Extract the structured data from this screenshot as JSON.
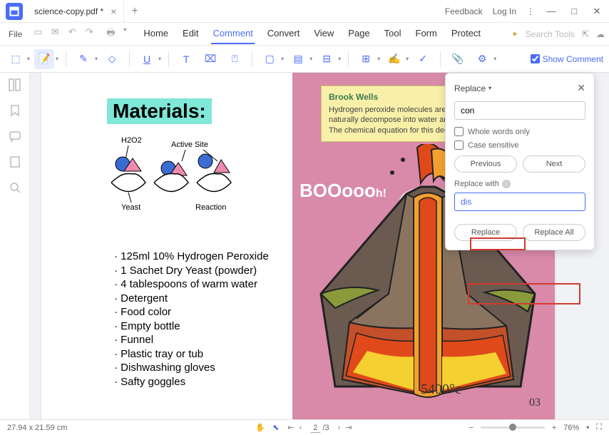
{
  "title": {
    "doc_name": "science-copy.pdf *",
    "feedback": "Feedback",
    "login": "Log In"
  },
  "menubar": {
    "file": "File",
    "items": [
      "Home",
      "Edit",
      "Comment",
      "Convert",
      "View",
      "Page",
      "Tool",
      "Form",
      "Protect"
    ],
    "active_index": 2,
    "search_placeholder": "Search Tools"
  },
  "toolbar": {
    "show_comment": "Show Comment"
  },
  "doc": {
    "materials_title": "Materials:",
    "diagram_labels": {
      "h2o2": "H2O2",
      "active": "Active Site",
      "yeast": "Yeast",
      "reaction": "Reaction"
    },
    "materials": [
      "125ml 10% Hydrogen Peroxide",
      "1 Sachet Dry Yeast (powder)",
      "4 tablespoons of warm water",
      "Detergent",
      "Food color",
      "Empty bottle",
      "Funnel",
      "Plastic tray or tub",
      "Dishwashing gloves",
      "Safty goggles"
    ],
    "note": {
      "author": "Brook Wells",
      "line1": "Hydrogen peroxide molecules are v",
      "line2": "naturally decompose into water and",
      "line3": "The chemical equation for this deco"
    },
    "boom": "BOOooo",
    "boom_suffix": "h!",
    "temperature": "5400°c",
    "page_number": "03"
  },
  "replace": {
    "title": "Replace",
    "search_value": "con",
    "whole_words": "Whole words only",
    "case_sensitive": "Case sensitive",
    "previous": "Previous",
    "next": "Next",
    "replace_with": "Replace with",
    "replace_value": "dis",
    "replace_btn": "Replace",
    "replace_all": "Replace All"
  },
  "status": {
    "dimensions": "27.94 x 21.59 cm",
    "page_current": "2",
    "page_total": "/3",
    "zoom": "76%"
  }
}
